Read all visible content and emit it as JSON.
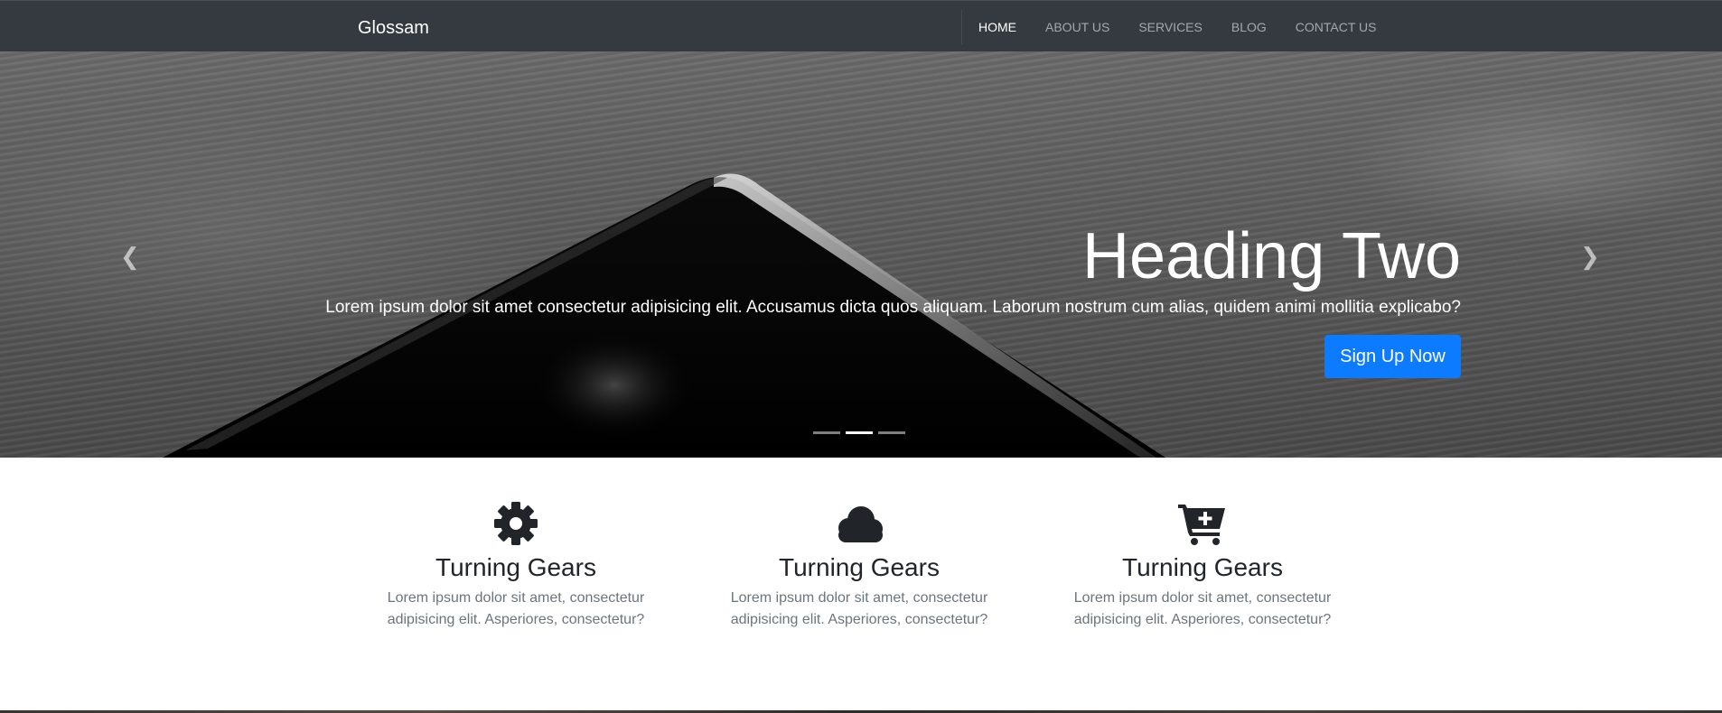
{
  "navbar": {
    "brand": "Glossam",
    "links": [
      {
        "label": "HOME",
        "active": true
      },
      {
        "label": "ABOUT US",
        "active": false
      },
      {
        "label": "SERVICES",
        "active": false
      },
      {
        "label": "BLOG",
        "active": false
      },
      {
        "label": "CONTACT US",
        "active": false
      }
    ]
  },
  "hero": {
    "heading": "Heading Two",
    "text": "Lorem ipsum dolor sit amet consectetur adipisicing elit. Accusamus dicta quos aliquam. Laborum nostrum cum alias, quidem animi mollitia explicabo?",
    "button_label": "Sign Up Now",
    "button_color": "#0d7bff",
    "prev_icon": "chevron-left-icon",
    "next_icon": "chevron-right-icon",
    "slides_count": 3,
    "active_slide": 2
  },
  "features": [
    {
      "icon": "gear-icon",
      "title": "Turning Gears",
      "text": "Lorem ipsum dolor sit amet, consectetur adipisicing elit. Asperiores, consectetur?"
    },
    {
      "icon": "cloud-icon",
      "title": "Turning Gears",
      "text": "Lorem ipsum dolor sit amet, consectetur adipisicing elit. Asperiores, consectetur?"
    },
    {
      "icon": "cart-plus-icon",
      "title": "Turning Gears",
      "text": "Lorem ipsum dolor sit amet, consectetur adipisicing elit. Asperiores, consectetur?"
    }
  ],
  "colors": {
    "navbar_bg": "#343a40",
    "feature_title": "#212529",
    "feature_text": "#6c757d"
  }
}
